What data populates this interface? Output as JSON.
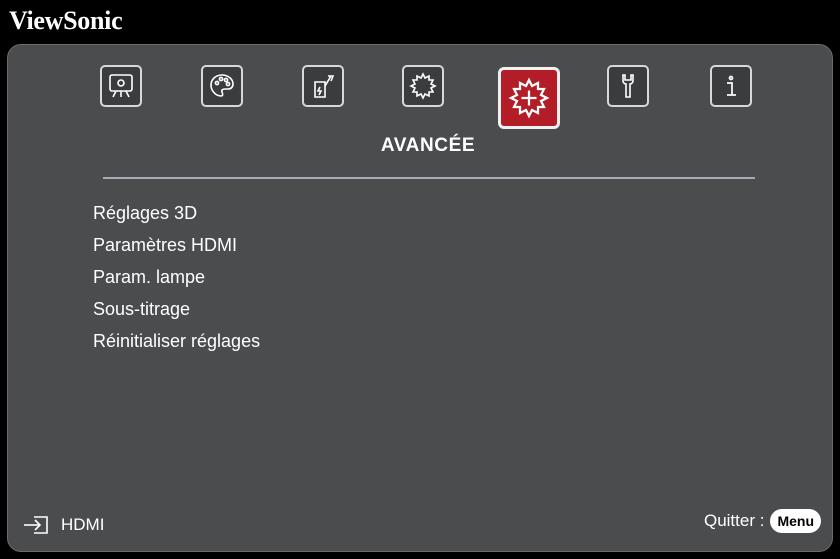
{
  "brand": "ViewSonic",
  "tabs": [
    {
      "icon": "image-icon",
      "active": false
    },
    {
      "icon": "palette-icon",
      "active": false
    },
    {
      "icon": "power-settings-icon",
      "active": false
    },
    {
      "icon": "gear-icon",
      "active": false
    },
    {
      "icon": "advanced-gear-icon",
      "active": true
    },
    {
      "icon": "wrench-icon",
      "active": false
    },
    {
      "icon": "info-icon",
      "active": false
    }
  ],
  "active_tab_label": "AVANCÉE",
  "menu": {
    "items": [
      "Réglages 3D",
      "Paramètres HDMI",
      "Param. lampe",
      "Sous-titrage",
      "Réinitialiser réglages"
    ]
  },
  "footer": {
    "source_label": "HDMI",
    "quit_label": "Quitter :",
    "menu_key": "Menu"
  },
  "colors": {
    "panel": "#4a4c4d",
    "accent": "#b21d27",
    "text": "#ffffff"
  }
}
